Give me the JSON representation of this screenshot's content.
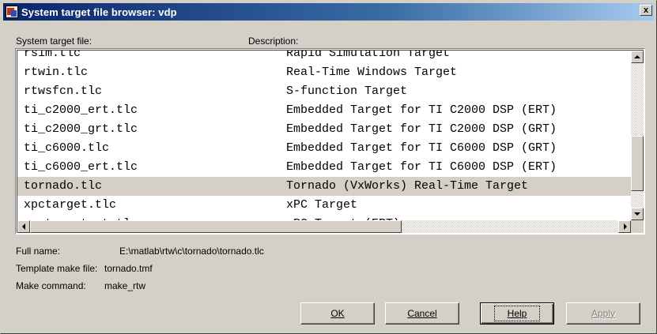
{
  "window": {
    "title": "System target file browser: vdp",
    "close_label": "x"
  },
  "columns": {
    "file": "System target file:",
    "description": "Description:"
  },
  "rows": [
    {
      "file": "rsim.tlc",
      "description": "Rapid Simulation Target"
    },
    {
      "file": "rtwin.tlc",
      "description": "Real-Time Windows Target"
    },
    {
      "file": "rtwsfcn.tlc",
      "description": "S-function Target"
    },
    {
      "file": "ti_c2000_ert.tlc",
      "description": "Embedded Target for TI C2000 DSP (ERT)"
    },
    {
      "file": "ti_c2000_grt.tlc",
      "description": "Embedded Target for TI C2000 DSP (GRT)"
    },
    {
      "file": "ti_c6000.tlc",
      "description": "Embedded Target for TI C6000 DSP (GRT)"
    },
    {
      "file": "ti_c6000_ert.tlc",
      "description": "Embedded Target for TI C6000 DSP (ERT)"
    },
    {
      "file": "tornado.tlc",
      "description": "Tornado (VxWorks) Real-Time Target"
    },
    {
      "file": "xpctarget.tlc",
      "description": "xPC Target"
    },
    {
      "file": "xpctargetert.tlc",
      "description": "xPC Target (ERT)"
    }
  ],
  "selected_row": 7,
  "info": {
    "full_name_label": "Full name:",
    "full_name_value": "E:\\matlab\\rtw\\c\\tornado\\tornado.tlc",
    "template_label": "Template make file:",
    "template_value": "tornado.tmf",
    "make_label": "Make command:",
    "make_value": "make_rtw"
  },
  "buttons": {
    "ok": "OK",
    "cancel": "Cancel",
    "help": "Help",
    "apply": "Apply"
  }
}
